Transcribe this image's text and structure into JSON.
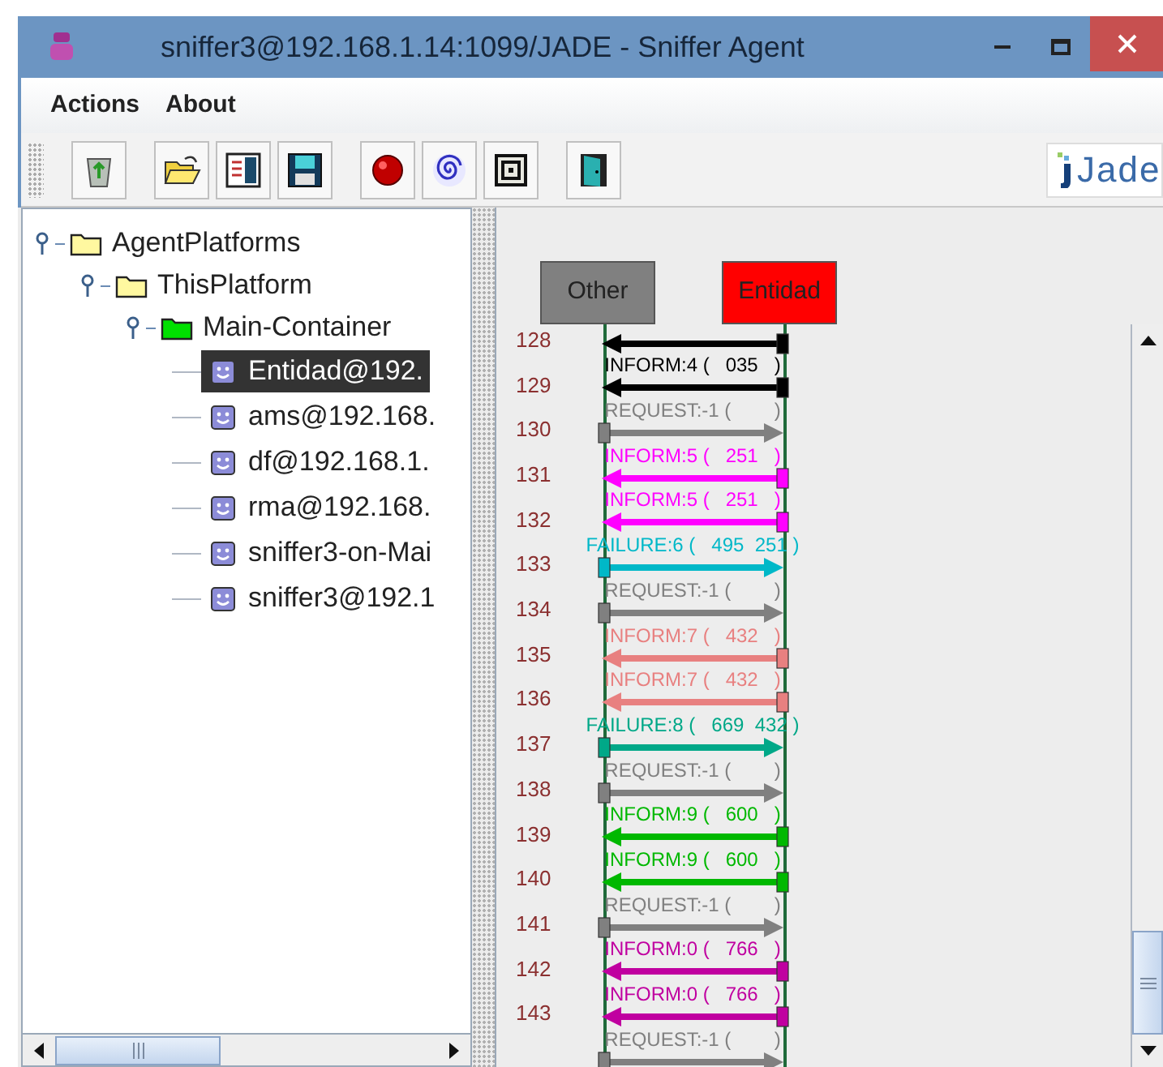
{
  "window": {
    "title": "sniffer3@192.168.1.14:1099/JADE - Sniffer Agent"
  },
  "menu": [
    "Actions",
    "About"
  ],
  "logo_text": "Jade",
  "tree": [
    {
      "label": "AgentPlatforms",
      "kind": "folder",
      "expanded": true,
      "children": [
        {
          "label": "ThisPlatform",
          "kind": "folder",
          "expanded": true,
          "children": [
            {
              "label": "Main-Container",
              "kind": "container",
              "expanded": true,
              "children": [
                {
                  "label": "Entidad@192.",
                  "kind": "agent",
                  "selected": true
                },
                {
                  "label": "ams@192.168.",
                  "kind": "agent",
                  "selected": false
                },
                {
                  "label": "df@192.168.1.",
                  "kind": "agent",
                  "selected": false
                },
                {
                  "label": "rma@192.168.",
                  "kind": "agent",
                  "selected": false
                },
                {
                  "label": "sniffer3-on-Mai",
                  "kind": "agent",
                  "selected": false
                },
                {
                  "label": "sniffer3@192.1",
                  "kind": "agent",
                  "selected": false
                }
              ]
            }
          ]
        }
      ]
    }
  ],
  "agents": [
    {
      "name": "Other",
      "color": "#808080"
    },
    {
      "name": "Entidad",
      "color": "#ff0000"
    }
  ],
  "messages": [
    {
      "line": "128",
      "color": "#000000",
      "kind": "left"
    },
    {
      "line": "129",
      "label": "INFORM:4 (   035   )",
      "color": "#000000",
      "kind": "left"
    },
    {
      "line": "130",
      "label": "REQUEST:-1 (        )",
      "color": "#808080",
      "kind": "right"
    },
    {
      "line": "131",
      "label": "INFORM:5 (   251   )",
      "color": "#ff00ff",
      "kind": "left"
    },
    {
      "line": "132",
      "label": "INFORM:5 (   251   )",
      "color": "#ff00ff",
      "kind": "left"
    },
    {
      "line": "133",
      "label": "FAILURE:6 (   495  251 )",
      "color": "#00b8c8",
      "kind": "right"
    },
    {
      "line": "134",
      "label": "REQUEST:-1 (        )",
      "color": "#808080",
      "kind": "right"
    },
    {
      "line": "135",
      "label": "INFORM:7 (   432   )",
      "color": "#e88080",
      "kind": "left"
    },
    {
      "line": "136",
      "label": "INFORM:7 (   432   )",
      "color": "#e88080",
      "kind": "left"
    },
    {
      "line": "137",
      "label": "FAILURE:8 (   669  432 )",
      "color": "#00a888",
      "kind": "right"
    },
    {
      "line": "138",
      "label": "REQUEST:-1 (        )",
      "color": "#808080",
      "kind": "right"
    },
    {
      "line": "139",
      "label": "INFORM:9 (   600   )",
      "color": "#00b800",
      "kind": "left"
    },
    {
      "line": "140",
      "label": "INFORM:9 (   600   )",
      "color": "#00b800",
      "kind": "left"
    },
    {
      "line": "141",
      "label": "REQUEST:-1 (        )",
      "color": "#808080",
      "kind": "right"
    },
    {
      "line": "142",
      "label": "INFORM:0 (   766   )",
      "color": "#c000a0",
      "kind": "left"
    },
    {
      "line": "143",
      "label": "INFORM:0 (   766   )",
      "color": "#c000a0",
      "kind": "left"
    },
    {
      "label": "REQUEST:-1 (        )",
      "color": "#808080",
      "kind": "right"
    }
  ]
}
